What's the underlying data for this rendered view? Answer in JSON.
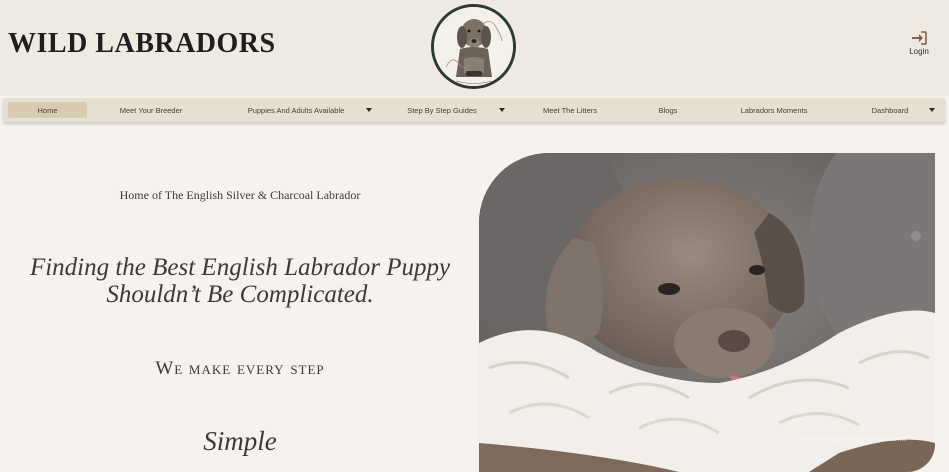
{
  "header": {
    "site_title": "WILD LABRADORS",
    "login_label": "Login"
  },
  "nav": {
    "items": [
      {
        "label": "Home"
      },
      {
        "label": "Meet Your Breeder"
      },
      {
        "label": "Puppies And Adults Available"
      },
      {
        "label": "Step By Step Guides"
      },
      {
        "label": "Meet The Litters"
      },
      {
        "label": "Blogs"
      },
      {
        "label": "Labradors Moments"
      },
      {
        "label": "Dashboard"
      }
    ]
  },
  "hero": {
    "tagline": "Home of The English Silver & Charcoal Labrador",
    "headline_line1": "Finding the Best English Labrador Puppy",
    "headline_line2": "Shouldn’t Be Complicated.",
    "subheading": "We make every step",
    "emphasis": "Simple",
    "watermark": "Go to Settings to activate Windows."
  },
  "colors": {
    "header_bg": "#eeeae2",
    "nav_bg": "#e7dfd0",
    "nav_active": "#d8cbb3",
    "page_bg": "#f6f3ee",
    "text": "#3a3a3a",
    "logo_ring": "#2c3a33",
    "login_icon": "#8b5e46"
  },
  "icons": {
    "login": "sign-in-icon",
    "dropdown": "caret-down-icon"
  }
}
